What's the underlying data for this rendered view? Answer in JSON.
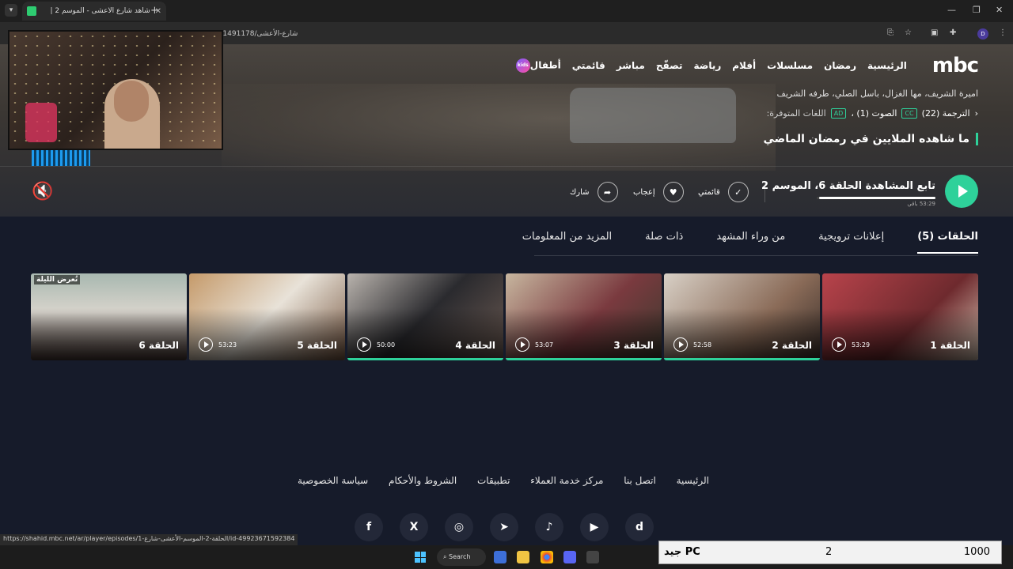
{
  "browser": {
    "tab_title": "شاهد شارع الأعشى - الموسم 2 |",
    "url": "/season-49922942971968-49923671491178/شارع-الأعشى",
    "status_url": "https://shahid.mbc.net/ar/player/episodes/1-الحلقة-2-الموسم-الأعشى-شارع/id-49923671592384"
  },
  "nav": {
    "logo": "mbc",
    "items": [
      "الرئيسية",
      "رمضان",
      "مسلسلات",
      "أفلام",
      "رياضة",
      "تصفّح",
      "مباشر",
      "قائمتي",
      "أطفال"
    ],
    "kids_badge": "kids"
  },
  "hero": {
    "cast": "اميرة الشريف، مها الغزال، باسل الصلي، طرفه الشريف",
    "languages_label": "اللغات المتوفرة:",
    "audio_tag": "AD",
    "audio_text": "الصوت (1) ،",
    "subs_tag": "CC",
    "subs_text": "الترجمة (22)",
    "tagline": "ما شاهده الملايين في رمضان الماضي",
    "continue_title": "تابع المشاهدة الحلقة 6، الموسم 2",
    "remaining": "53:29 باقي",
    "progress": 0.02,
    "actions": {
      "list": "قائمتي",
      "like": "إعجاب",
      "share": "شارك"
    }
  },
  "tabs": [
    "الحلقات (5)",
    "إعلانات ترويجية",
    "من وراء المشهد",
    "ذات صلة",
    "المزيد من المعلومات"
  ],
  "episodes": [
    {
      "title": "الحلقة 1",
      "duration": "53:29",
      "watched": 0
    },
    {
      "title": "الحلقة 2",
      "duration": "52:58",
      "watched": 1
    },
    {
      "title": "الحلقة 3",
      "duration": "53:07",
      "watched": 1
    },
    {
      "title": "الحلقة 4",
      "duration": "50:00",
      "watched": 1
    },
    {
      "title": "الحلقة 5",
      "duration": "53:23",
      "watched": 0
    },
    {
      "title": "الحلقة 6",
      "duration": "",
      "badge": "تُعرض الليلة",
      "watched": 0
    }
  ],
  "footer": {
    "links": [
      "الرئيسية",
      "اتصل بنا",
      "مركز خدمة العملاء",
      "تطبيقات",
      "الشروط والأحكام",
      "سياسة الخصوصية"
    ],
    "socials": [
      "f",
      "X",
      "◎",
      "➤",
      "♪",
      "▶",
      "d"
    ]
  },
  "taskbar": {
    "search": "Search"
  },
  "overlay": {
    "left": "جيد PC",
    "middle": "2",
    "right": "1000"
  },
  "colors": {
    "accent": "#2ed19a",
    "background": "#161b2a"
  }
}
